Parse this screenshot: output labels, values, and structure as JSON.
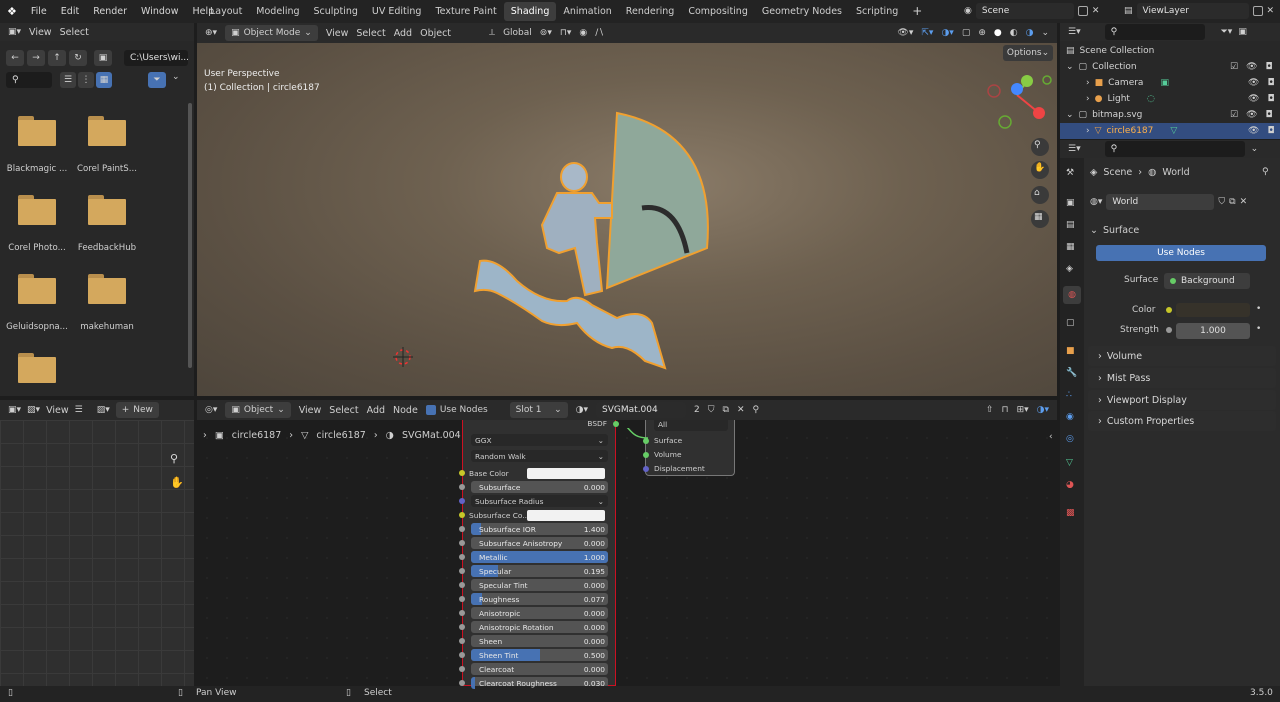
{
  "top_menu": {
    "file": "File",
    "edit": "Edit",
    "render": "Render",
    "window": "Window",
    "help": "Help"
  },
  "workspaces": [
    "Layout",
    "Modeling",
    "Sculpting",
    "UV Editing",
    "Texture Paint",
    "Shading",
    "Animation",
    "Rendering",
    "Compositing",
    "Geometry Nodes",
    "Scripting"
  ],
  "active_workspace": "Shading",
  "scene_name": "Scene",
  "view_layer": "ViewLayer",
  "file_browser": {
    "menu_view": "View",
    "menu_select": "Select",
    "path": "C:\\Users\\wi...",
    "items": [
      "Blackmagic ...",
      "Corel PaintS...",
      "Corel Photo...",
      "FeedbackHub",
      "Geluidsopna...",
      "makehuman",
      ""
    ]
  },
  "viewport": {
    "mode": "Object Mode",
    "menu_view": "View",
    "menu_select": "Select",
    "menu_add": "Add",
    "menu_object": "Object",
    "transform": "Global",
    "options": "Options",
    "perspective": "User Perspective",
    "collection_info": "(1) Collection | circle6187"
  },
  "image_editor": {
    "menu_view": "View",
    "new_label": "New"
  },
  "node_editor": {
    "object_label": "Object",
    "menu_view": "View",
    "menu_select": "Select",
    "menu_add": "Add",
    "menu_node": "Node",
    "use_nodes": "Use Nodes",
    "slot": "Slot 1",
    "material": "SVGMat.004",
    "users": "2",
    "breadcrumb": [
      "circle6187",
      "circle6187",
      "SVGMat.004"
    ],
    "bsdf_header": "BSDF",
    "distribution": "GGX",
    "subsurface_method": "Random Walk",
    "props": [
      {
        "label": "Base Color",
        "value": "",
        "type": "color"
      },
      {
        "label": "Subsurface",
        "value": "0.000",
        "fill": 0
      },
      {
        "label": "Subsurface Radius",
        "value": "",
        "type": "dropdown"
      },
      {
        "label": "Subsurface Co...",
        "value": "",
        "type": "color"
      },
      {
        "label": "Subsurface IOR",
        "value": "1.400",
        "fill": 0.07
      },
      {
        "label": "Subsurface Anisotropy",
        "value": "0.000",
        "fill": 0
      },
      {
        "label": "Metallic",
        "value": "1.000",
        "fill": 1
      },
      {
        "label": "Specular",
        "value": "0.195",
        "fill": 0.195
      },
      {
        "label": "Specular Tint",
        "value": "0.000",
        "fill": 0
      },
      {
        "label": "Roughness",
        "value": "0.077",
        "fill": 0.077
      },
      {
        "label": "Anisotropic",
        "value": "0.000",
        "fill": 0
      },
      {
        "label": "Anisotropic Rotation",
        "value": "0.000",
        "fill": 0
      },
      {
        "label": "Sheen",
        "value": "0.000",
        "fill": 0
      },
      {
        "label": "Sheen Tint",
        "value": "0.500",
        "fill": 0.5
      },
      {
        "label": "Clearcoat",
        "value": "0.000",
        "fill": 0
      },
      {
        "label": "Clearcoat Roughness",
        "value": "0.030",
        "fill": 0.03
      }
    ],
    "output_node": {
      "target": "All",
      "sockets": [
        "Surface",
        "Volume",
        "Displacement"
      ]
    }
  },
  "outliner": {
    "scene_collection": "Scene Collection",
    "items": [
      {
        "label": "Collection"
      },
      {
        "label": "Camera"
      },
      {
        "label": "Light"
      },
      {
        "label": "bitmap.svg"
      },
      {
        "label": "circle6187"
      }
    ]
  },
  "properties": {
    "breadcrumb_scene": "Scene",
    "breadcrumb_world": "World",
    "world_name": "World",
    "surface_section": "Surface",
    "use_nodes": "Use Nodes",
    "surface_label": "Surface",
    "surface_value": "Background",
    "color_label": "Color",
    "strength_label": "Strength",
    "strength_value": "1.000",
    "sections": [
      "Volume",
      "Mist Pass",
      "Viewport Display",
      "Custom Properties"
    ]
  },
  "status": {
    "pan": "Pan View",
    "select": "Select",
    "version": "3.5.0"
  }
}
